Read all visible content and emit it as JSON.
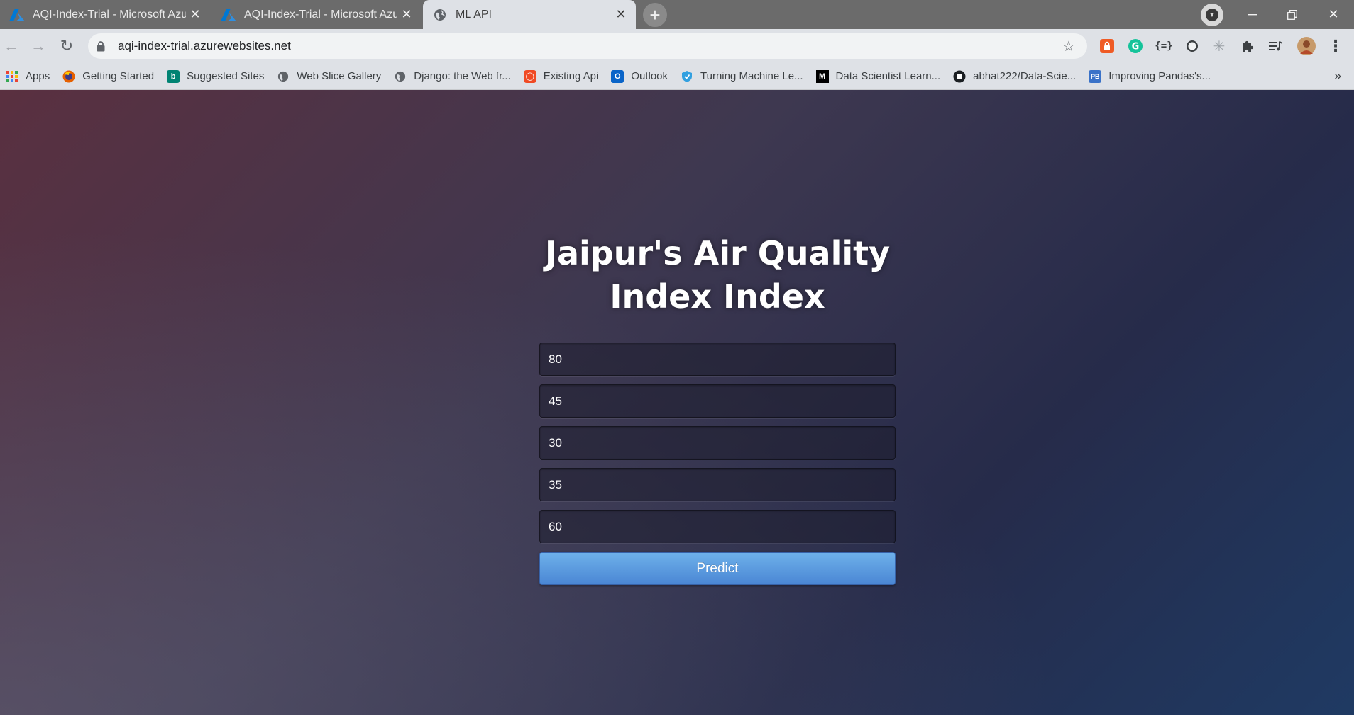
{
  "browser": {
    "tabs": [
      {
        "title": "AQI-Index-Trial - Microsoft Azure",
        "icon": "azure-icon",
        "active": false
      },
      {
        "title": "AQI-Index-Trial - Microsoft Azure",
        "icon": "azure-icon",
        "active": false
      },
      {
        "title": "ML API",
        "icon": "globe-icon",
        "active": true
      }
    ],
    "url": "aqi-index-trial.azurewebsites.net",
    "bookmarks": [
      {
        "label": "Apps",
        "icon": "apps-grid-icon"
      },
      {
        "label": "Getting Started",
        "icon": "firefox-icon"
      },
      {
        "label": "Suggested Sites",
        "icon": "bing-icon"
      },
      {
        "label": "Web Slice Gallery",
        "icon": "globe-icon"
      },
      {
        "label": "Django: the Web fr...",
        "icon": "globe-icon"
      },
      {
        "label": "Existing Api",
        "icon": "api-icon"
      },
      {
        "label": "Outlook",
        "icon": "outlook-icon"
      },
      {
        "label": "Turning Machine Le...",
        "icon": "shield-icon"
      },
      {
        "label": "Data Scientist Learn...",
        "icon": "medium-icon"
      },
      {
        "label": "abhat222/Data-Scie...",
        "icon": "github-icon"
      },
      {
        "label": "Improving Pandas's...",
        "icon": "pb-icon"
      }
    ],
    "accent_colors": {
      "azure": "#0078d4",
      "predict_button": "#5a9be0"
    }
  },
  "page": {
    "heading_line1": "Jaipur's Air Quality",
    "heading_line2": "Index Index",
    "inputs": [
      {
        "value": "80"
      },
      {
        "value": "45"
      },
      {
        "value": "30"
      },
      {
        "value": "35"
      },
      {
        "value": "60"
      }
    ],
    "predict_label": "Predict"
  }
}
